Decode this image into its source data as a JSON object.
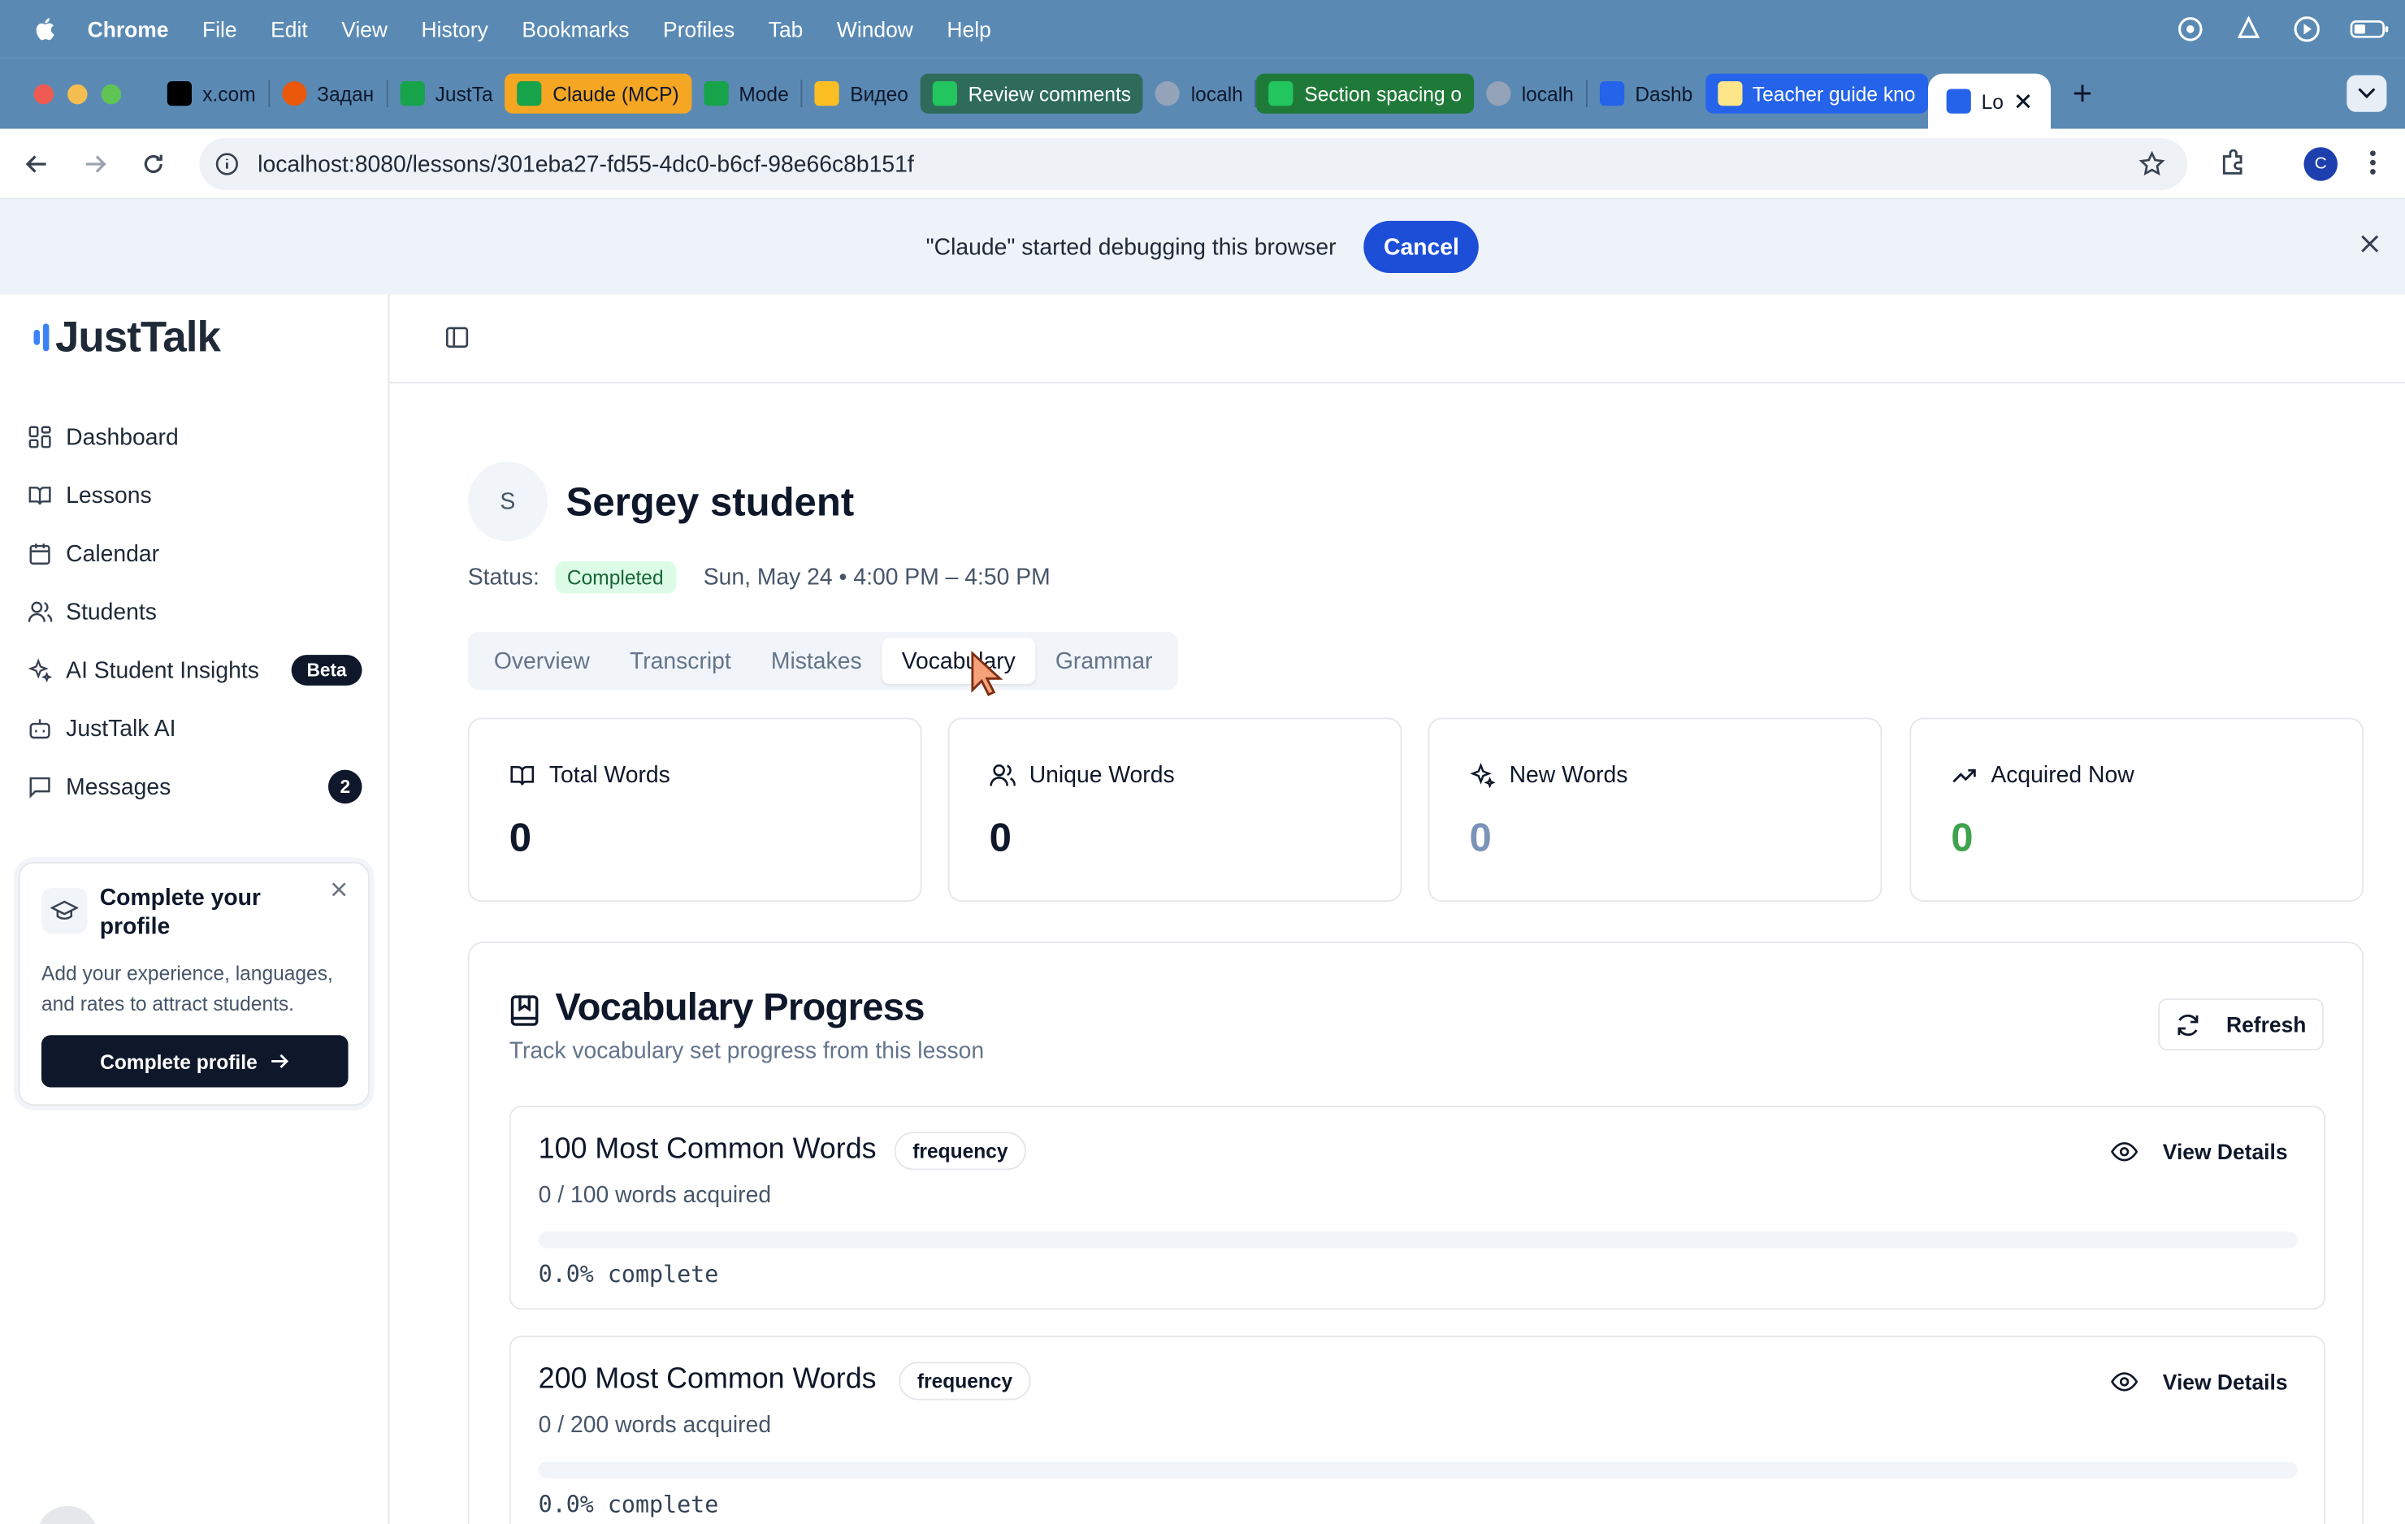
{
  "menubar": {
    "app": "Chrome",
    "items": [
      "File",
      "Edit",
      "View",
      "History",
      "Bookmarks",
      "Profiles",
      "Tab",
      "Window",
      "Help"
    ]
  },
  "tabs": [
    {
      "label": "x.com",
      "color": "#000000"
    },
    {
      "label": "Задан",
      "color": "#ea580c"
    },
    {
      "label": "JustTa",
      "color": "#16a34a"
    },
    {
      "label": "Claude (MCP)",
      "color": "#f59e0b",
      "pill": "#f5a623"
    },
    {
      "label": "Mode",
      "color": "#16a34a"
    },
    {
      "label": "Видео",
      "color": "#fbbf24"
    },
    {
      "label": "Review comments",
      "color": "#22c55e",
      "pill": "#2f6b5a"
    },
    {
      "label": "localh",
      "color": "#64748b"
    },
    {
      "label": "Section spacing o",
      "color": "#22c55e",
      "pill": "#1f7a3a"
    },
    {
      "label": "localh",
      "color": "#64748b"
    },
    {
      "label": "Dashb",
      "color": "#2563eb"
    },
    {
      "label": "Teacher guide kno",
      "color": "#fde68a",
      "pill": "#2563eb"
    },
    {
      "label": "Lo",
      "color": "#2563eb",
      "active": true
    }
  ],
  "address": {
    "url": "localhost:8080/lessons/301eba27-fd55-4dc0-b6cf-98e66c8b151f",
    "profile_initial": "C"
  },
  "debug": {
    "message": "\"Claude\" started debugging this browser",
    "cancel": "Cancel"
  },
  "sidebar": {
    "brand": "JustTalk",
    "items": [
      {
        "label": "Dashboard",
        "icon": "dashboard-icon"
      },
      {
        "label": "Lessons",
        "icon": "book-icon"
      },
      {
        "label": "Calendar",
        "icon": "calendar-icon"
      },
      {
        "label": "Students",
        "icon": "users-icon"
      },
      {
        "label": "AI Student Insights",
        "icon": "sparkles-icon",
        "badge": "Beta"
      },
      {
        "label": "JustTalk AI",
        "icon": "bot-icon"
      },
      {
        "label": "Messages",
        "icon": "message-icon",
        "count": "2"
      }
    ],
    "profile_card": {
      "title": "Complete your profile",
      "description": "Add your experience, languages, and rates to attract students.",
      "cta": "Complete profile"
    }
  },
  "lesson": {
    "avatar_initial": "S",
    "student_name": "Sergey student",
    "status_label": "Status:",
    "status": "Completed",
    "datetime": "Sun, May 24 • 4:00 PM – 4:50 PM",
    "tabs": [
      "Overview",
      "Transcript",
      "Mistakes",
      "Vocabulary",
      "Grammar"
    ],
    "active_tab": "Vocabulary"
  },
  "stats": [
    {
      "label": "Total Words",
      "value": "0",
      "color": "#0f172a",
      "icon": "book-open-icon"
    },
    {
      "label": "Unique Words",
      "value": "0",
      "color": "#0f172a",
      "icon": "users-icon"
    },
    {
      "label": "New Words",
      "value": "0",
      "color": "#7b93b8",
      "icon": "sparkles-icon"
    },
    {
      "label": "Acquired Now",
      "value": "0",
      "color": "#3fa34d",
      "icon": "trending-up-icon"
    }
  ],
  "vocab": {
    "title": "Vocabulary Progress",
    "subtitle": "Track vocabulary set progress from this lesson",
    "refresh": "Refresh",
    "sets": [
      {
        "name": "100 Most Common Words",
        "tag": "frequency",
        "acquired": "0 / 100 words acquired",
        "percent": "0.0% complete",
        "progress": 0.0,
        "details": "View Details"
      },
      {
        "name": "200 Most Common Words",
        "tag": "frequency",
        "acquired": "0 / 200 words acquired",
        "percent": "0.0% complete",
        "progress": 0.0,
        "details": "View Details"
      }
    ]
  }
}
